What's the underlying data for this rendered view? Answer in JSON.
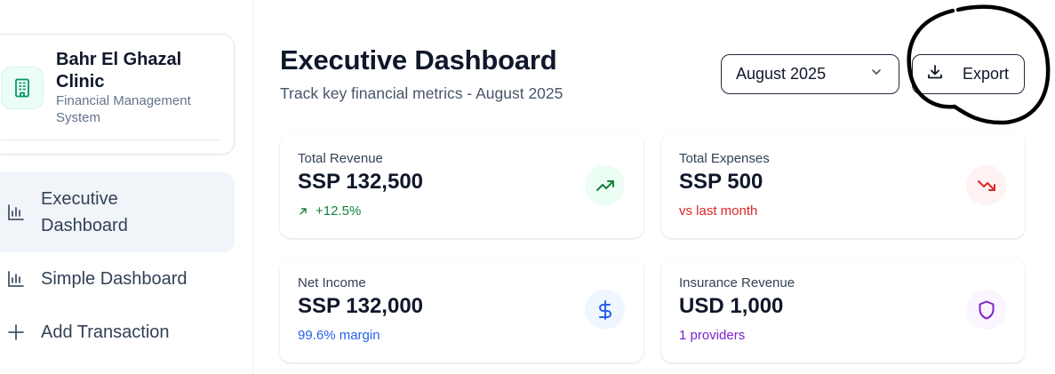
{
  "brand": {
    "name": "Bahr El Ghazal Clinic",
    "subtitle": "Financial Management System",
    "logo_icon": "building-icon"
  },
  "nav": [
    {
      "label": "Executive Dashboard",
      "icon": "bar-chart-icon",
      "active": true
    },
    {
      "label": "Simple Dashboard",
      "icon": "bar-chart-icon",
      "active": false
    },
    {
      "label": "Add Transaction",
      "icon": "plus-icon",
      "active": false
    }
  ],
  "header": {
    "title": "Executive Dashboard",
    "subtitle": "Track key financial metrics - August 2025"
  },
  "controls": {
    "month_value": "August 2025",
    "export_label": "Export"
  },
  "cards": [
    {
      "label": "Total Revenue",
      "value": "SSP 132,500",
      "foot": "+12.5%",
      "foot_icon": "arrow-up-right-icon",
      "icon": "trending-up-icon",
      "color": "#15803d",
      "badge_bg": "#ecfdf3"
    },
    {
      "label": "Total Expenses",
      "value": "SSP 500",
      "foot": "vs last month",
      "icon": "trending-down-icon",
      "color": "#dc2626",
      "badge_bg": "#fef2f2"
    },
    {
      "label": "Net Income",
      "value": "SSP 132,000",
      "foot": "99.6% margin",
      "icon": "dollar-icon",
      "color": "#2563eb",
      "badge_bg": "#eff6ff"
    },
    {
      "label": "Insurance Revenue",
      "value": "USD 1,000",
      "foot": "1 providers",
      "icon": "shield-icon",
      "color": "#7e22ce",
      "badge_bg": "#faf5ff"
    }
  ],
  "colors": {
    "accent_green": "#059669",
    "border_dark": "#1e293b",
    "nav_active_bg": "#f1f5f9"
  }
}
